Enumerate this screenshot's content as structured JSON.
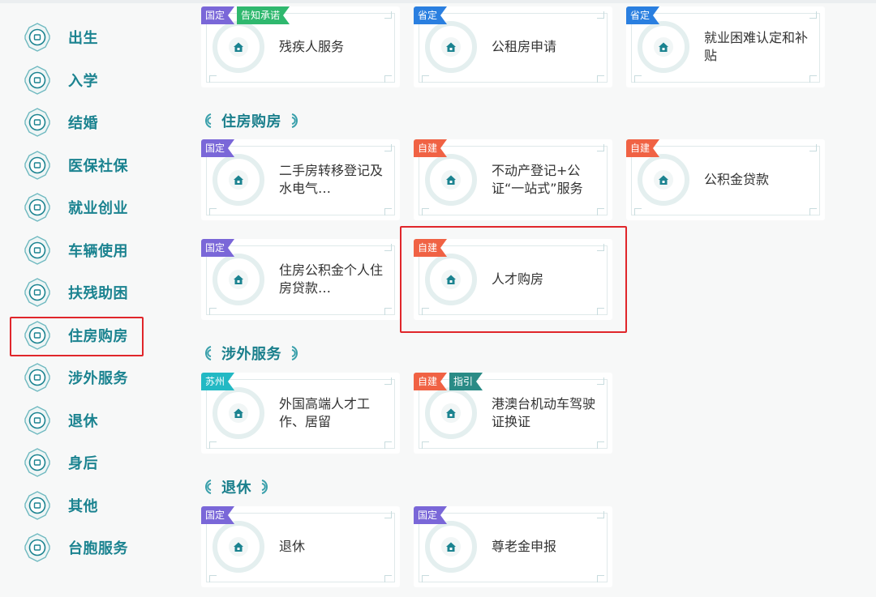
{
  "sidebar": {
    "items": [
      {
        "label": "出生",
        "icon": "baby-bottle-icon"
      },
      {
        "label": "入学",
        "icon": "school-icon"
      },
      {
        "label": "结婚",
        "icon": "rings-icon"
      },
      {
        "label": "医保社保",
        "icon": "medical-shield-icon"
      },
      {
        "label": "就业创业",
        "icon": "briefcase-icon"
      },
      {
        "label": "车辆使用",
        "icon": "car-icon"
      },
      {
        "label": "扶残助困",
        "icon": "helping-hand-icon"
      },
      {
        "label": "住房购房",
        "icon": "house-icon"
      },
      {
        "label": "涉外服务",
        "icon": "globe-icon"
      },
      {
        "label": "退休",
        "icon": "wheelchair-icon"
      },
      {
        "label": "身后",
        "icon": "memorial-icon"
      },
      {
        "label": "其他",
        "icon": "grid-icon"
      },
      {
        "label": "台胞服务",
        "icon": "tai-icon"
      }
    ],
    "selected": "住房购房"
  },
  "sections": {
    "housing": "住房购房",
    "foreign": "涉外服务",
    "retire": "退休"
  },
  "cards": {
    "top1": {
      "name": "残疾人服务",
      "tags": [
        "国定",
        "告知承诺"
      ],
      "icon": "wheelchair-icon"
    },
    "top2": {
      "name": "公租房申请",
      "tags": [
        "省定"
      ],
      "icon": "house-icon"
    },
    "top3": {
      "name": "就业困难认定和补贴",
      "tags": [
        "省定"
      ],
      "icon": "briefcase-icon"
    },
    "h1": {
      "name": "二手房转移登记及水电气…",
      "tags": [
        "国定"
      ],
      "icon": "house-icon"
    },
    "h2": {
      "name": "不动产登记+公证“一站式”服务",
      "tags": [
        "自建"
      ],
      "icon": "house-icon"
    },
    "h3": {
      "name": "公积金贷款",
      "tags": [
        "自建"
      ],
      "icon": "house-up-icon"
    },
    "h4": {
      "name": "住房公积金个人住房贷款…",
      "tags": [
        "国定"
      ],
      "icon": "house-icon"
    },
    "h5": {
      "name": "人才购房",
      "tags": [
        "自建"
      ],
      "icon": "house-person-icon"
    },
    "f1": {
      "name": "外国高端人才工作、居留",
      "tags": [
        "苏州"
      ],
      "icon": "monitor-icon"
    },
    "f2": {
      "name": "港澳台机动车驾驶证换证",
      "tags": [
        "自建",
        "指引"
      ],
      "icon": "car-license-icon"
    },
    "r1": {
      "name": "退休",
      "tags": [
        "国定"
      ],
      "icon": "person-icon"
    },
    "r2": {
      "name": "尊老金申报",
      "tags": [
        "国定"
      ],
      "icon": "elder-care-icon"
    }
  },
  "colors": {
    "accent": "#1b8390",
    "highlight": "#e0262b",
    "tag_guo": "#7a67d8",
    "tag_sheng": "#2a7fe0",
    "tag_zi": "#f06244",
    "tag_gao": "#2fb86e",
    "tag_su": "#23b9c4",
    "tag_zhi": "#2a8b86"
  }
}
